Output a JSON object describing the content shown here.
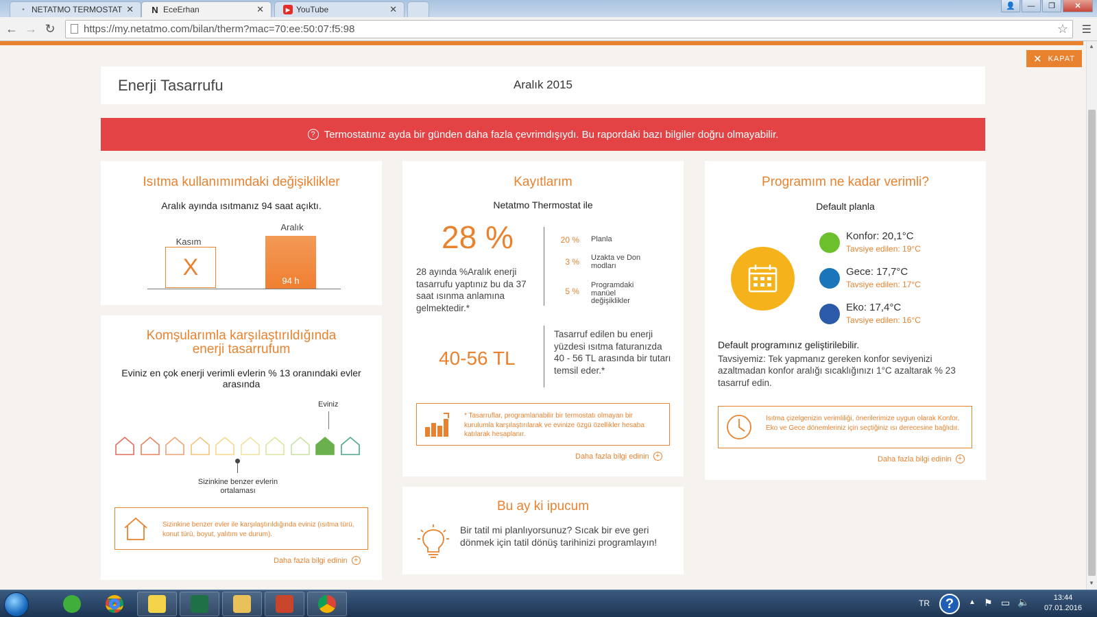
{
  "browser": {
    "tabs": [
      {
        "label": "NETATMO TERMOSTAT P/",
        "favicon": "•"
      },
      {
        "label": "EceErhan",
        "favicon": "N"
      },
      {
        "label": "YouTube",
        "favicon": "▶"
      }
    ],
    "url": "https://my.netatmo.com/bilan/therm?mac=70:ee:50:07:f5:98"
  },
  "page": {
    "close_label": "KAPAT",
    "title": "Enerji Tasarrufu",
    "month": "Aralık 2015",
    "alert": "Termostatınız ayda bir günden daha fazla çevrimdışıydı. Bu rapordaki bazı bilgiler doğru olmayabilir."
  },
  "heating": {
    "title": "Isıtma kullanımımdaki değişiklikler",
    "subtitle": "Aralık ayında ısıtmanız 94 saat açıktı.",
    "chart_data": {
      "type": "bar",
      "categories": [
        "Kasım",
        "Aralık"
      ],
      "values": [
        null,
        94
      ],
      "value_labels": [
        "X",
        "94 h"
      ]
    }
  },
  "neighbors": {
    "title": "Komşularımla karşılaştırıldığında enerji tasarrufum",
    "subtitle": "Eviniz en çok enerji verimli evlerin % 13 oranındaki evler arasında",
    "your_home_label": "Eviniz",
    "average_label": "Sizinkine benzer evlerin ortalaması",
    "info": "Sizinkine benzer evler ile karşılaştırıldığında eviniz (ısıtma türü, konut türü, boyut, yalıtım ve durum).",
    "link": "Daha fazla bilgi edinin",
    "house_colors": [
      "#e26a5a",
      "#e8805d",
      "#f0a070",
      "#f2c27a",
      "#f5d98a",
      "#efe29a",
      "#dde4a0",
      "#c8e0a4",
      "#6ab04c",
      "#4aa68c"
    ],
    "your_home_index": 8,
    "average_index": 4
  },
  "records": {
    "title": "Kayıtlarım",
    "subtitle": "Netatmo Thermostat ile",
    "big_percent": "28 %",
    "big_percent_text": "28 ayında %Aralık enerji tasarrufu yaptınız bu da 37 saat ısınma anlamına gelmektedir.*",
    "breakdown": [
      {
        "value": "20 %",
        "label": "Planla"
      },
      {
        "value": "3 %",
        "label": "Uzakta ve Don modları"
      },
      {
        "value": "5 %",
        "label": "Programdaki manüel değişiklikler"
      }
    ],
    "money": "40-56 TL",
    "money_text": "Tasarruf edilen bu enerji yüzdesi ısıtma faturanızda 40 - 56 TL arasında bir tutarı temsil eder.*",
    "info": "* Tasarruflar, programlanabilir bir termostatı olmayan bir kurulumla karşılaştırılarak ve evinize özgü özellikler hesaba katılarak hesaplanır.",
    "link": "Daha fazla bilgi edinin"
  },
  "program": {
    "title": "Programım ne kadar verimli?",
    "subtitle": "Default planla",
    "temps": [
      {
        "name": "Konfor: 20,1°C",
        "recommended": "Tavsiye edilen: 19°C",
        "color": "#6cc02c"
      },
      {
        "name": "Gece: 17,7°C",
        "recommended": "Tavsiye edilen: 17°C",
        "color": "#1a75bb"
      },
      {
        "name": "Eko: 17,4°C",
        "recommended": "Tavsiye edilen: 16°C",
        "color": "#2a5aa8"
      }
    ],
    "improvable": "Default programınız geliştirilebilir.",
    "advice": "Tavsiyemiz: Tek yapmanız gereken konfor seviyenizi azaltmadan konfor aralığı sıcaklığınızı 1°C azaltarak % 23 tasarruf edin.",
    "info": "Isıtma çizelgenizin verimliliği, önerilerimize uygun olarak Konfor, Eko ve Gece dönemleriniz için seçtiğiniz ısı derecesine bağlıdır.",
    "link": "Daha fazla bilgi edinin"
  },
  "tip": {
    "title": "Bu ay ki ipucum",
    "text": "Bir tatil mi planlıyorsunuz? Sıcak bir eve geri dönmek için tatil dönüş tarihinizi programlayın!"
  },
  "taskbar": {
    "language": "TR",
    "time": "13:44",
    "date": "07.01.2016"
  }
}
